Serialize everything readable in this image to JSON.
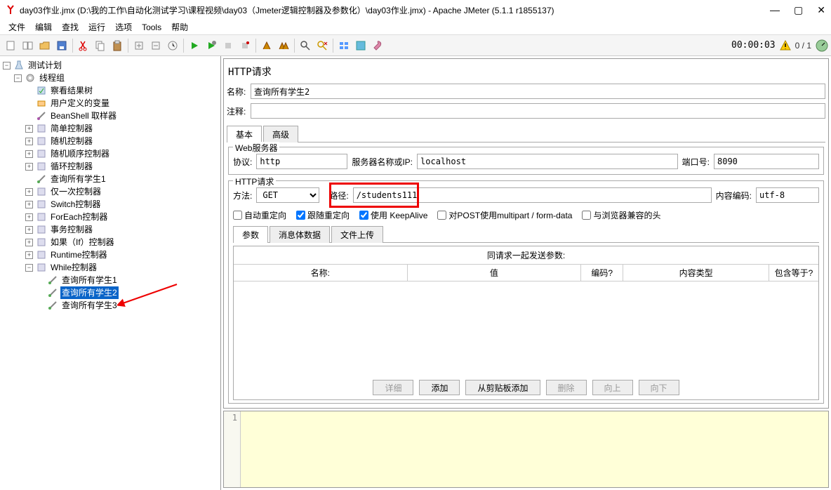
{
  "window": {
    "title": "day03作业.jmx (D:\\我的工作\\自动化测试学习\\课程视频\\day03（Jmeter逻辑控制器及参数化）\\day03作业.jmx) - Apache JMeter (5.1.1 r1855137)"
  },
  "menu": [
    "文件",
    "编辑",
    "查找",
    "运行",
    "选项",
    "Tools",
    "帮助"
  ],
  "toolbar_time": "00:00:03",
  "toolbar_counter": "0 / 1",
  "tree": {
    "root": "测试计划",
    "thread_group": "线程组",
    "items": [
      "察看结果树",
      "用户定义的变量",
      "BeanShell 取样器",
      "简单控制器",
      "随机控制器",
      "随机顺序控制器",
      "循环控制器",
      "查询所有学生1",
      "仅一次控制器",
      "Switch控制器",
      "ForEach控制器",
      "事务控制器",
      "如果（If）控制器",
      "Runtime控制器",
      "While控制器"
    ],
    "while_children": [
      "查询所有学生1",
      "查询所有学生2",
      "查询所有学生3"
    ],
    "selected": "查询所有学生2"
  },
  "panel": {
    "title": "HTTP请求",
    "name_label": "名称:",
    "name_value": "查询所有学生2",
    "comment_label": "注释:",
    "comment_value": "",
    "tabs": [
      "基本",
      "高级"
    ],
    "web_legend": "Web服务器",
    "protocol_label": "协议:",
    "protocol_value": "http",
    "server_label": "服务器名称或IP:",
    "server_value": "localhost",
    "port_label": "端口号:",
    "port_value": "8090",
    "http_legend": "HTTP请求",
    "method_label": "方法:",
    "method_value": "GET",
    "path_label": "路径:",
    "path_value": "/students111",
    "encoding_label": "内容编码:",
    "encoding_value": "utf-8",
    "chk_auto": "自动重定向",
    "chk_follow": "跟随重定向",
    "chk_keepalive": "使用 KeepAlive",
    "chk_multipart": "对POST使用multipart / form-data",
    "chk_browser": "与浏览器兼容的头",
    "inner_tabs": [
      "参数",
      "消息体数据",
      "文件上传"
    ],
    "param_title": "同请求一起发送参数:",
    "param_headers": [
      "名称:",
      "值",
      "编码?",
      "内容类型",
      "包含等于?"
    ],
    "buttons": [
      "详细",
      "添加",
      "从剪贴板添加",
      "删除",
      "向上",
      "向下"
    ]
  },
  "bottom_line": "1"
}
